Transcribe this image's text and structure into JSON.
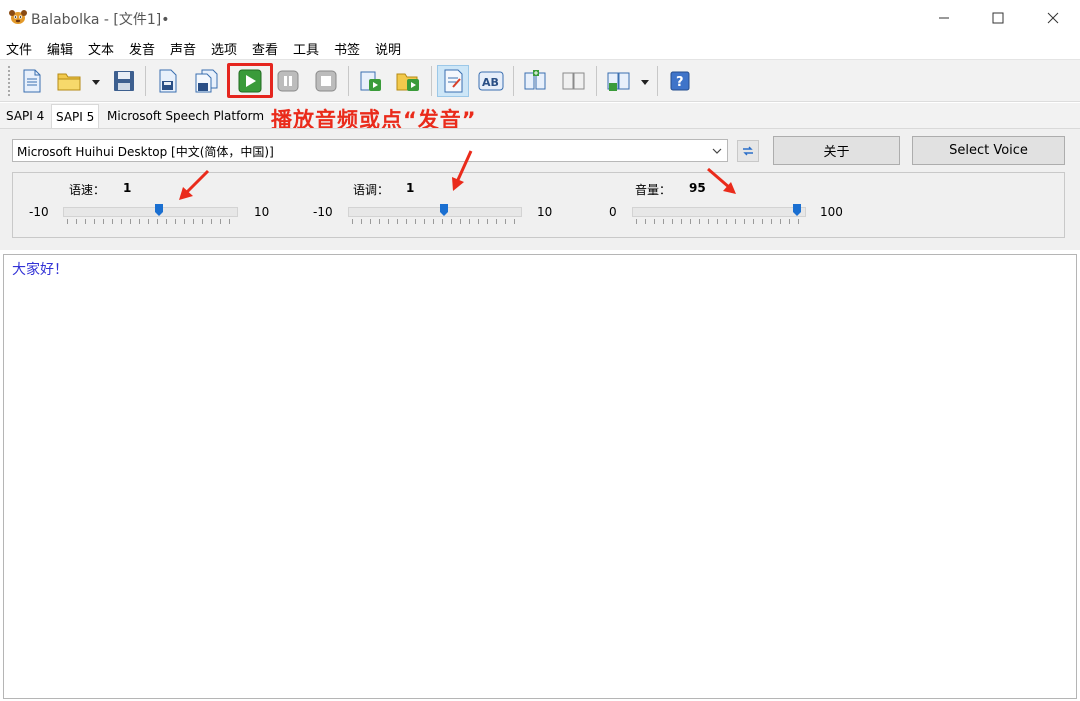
{
  "window": {
    "title": "Balabolka - [文件1]•"
  },
  "menu": [
    "文件",
    "编辑",
    "文本",
    "发音",
    "声音",
    "选项",
    "查看",
    "工具",
    "书签",
    "说明"
  ],
  "tabs": [
    "SAPI 4",
    "SAPI 5",
    "Microsoft Speech Platform"
  ],
  "selected_tab": "SAPI 5",
  "annotation": "播放音频或点“发音”",
  "voice": {
    "selected": "Microsoft Huihui Desktop [中文(简体，中国)]",
    "about_label": "关于",
    "select_voice_label": "Select Voice"
  },
  "sliders": {
    "rate": {
      "label": "语速：",
      "value": "1",
      "min": "-10",
      "max": "10",
      "level": 0.55
    },
    "pitch": {
      "label": "语调：",
      "value": "1",
      "min": "-10",
      "max": "10",
      "level": 0.55
    },
    "volume": {
      "label": "音量：",
      "value": "95",
      "min": "0",
      "max": "100",
      "level": 0.95
    }
  },
  "editor": {
    "text": "大家好！"
  },
  "colors": {
    "annotation": "#ea2b1b",
    "editor_text": "#3232d6",
    "slider_thumb": "#1a6fd1"
  }
}
